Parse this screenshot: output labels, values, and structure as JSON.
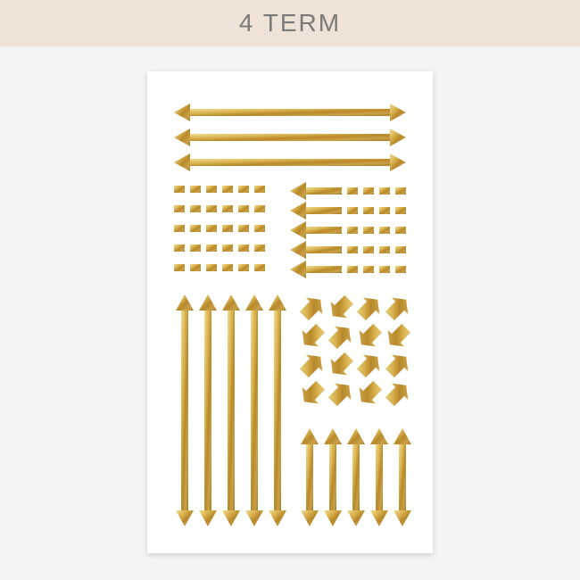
{
  "banner": {
    "title": "4 TERM"
  },
  "product": {
    "name": "gold-foil-arrow-sticker-sheet",
    "colors": {
      "gold_light": "#e6c66a",
      "gold_dark": "#a77c1e",
      "banner_bg": "#eee3d6",
      "stage_bg": "#f4f4f4"
    }
  }
}
